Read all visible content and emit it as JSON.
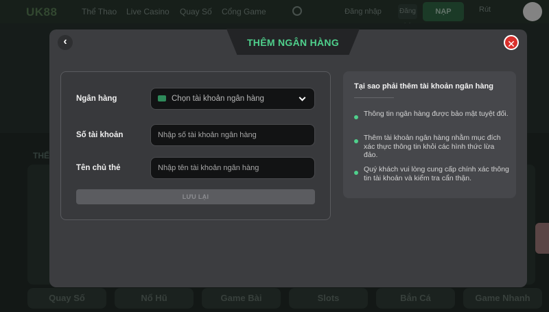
{
  "background": {
    "logo": "UK88",
    "nav": [
      "Thể Thao",
      "Live Casino",
      "Quay Số",
      "Cổng Game"
    ],
    "login_label": "Đăng nhập",
    "signup_label": "Đăng ký",
    "deposit_label": "NẠP",
    "withdraw_label": "Rút",
    "section_title": "THỂ",
    "bottom_tabs": [
      "Quay Số",
      "Nổ Hũ",
      "Game Bài",
      "Slots",
      "Bắn Cá",
      "Game Nhanh"
    ]
  },
  "modal": {
    "title": "THÊM NGÂN HÀNG",
    "back_icon": "‹",
    "close_icon": "✕",
    "form": {
      "bank_label": "Ngân hàng",
      "bank_select_value": "Chọn tài khoản ngân hàng",
      "account_number_label": "Số tài khoản",
      "account_number_placeholder": "Nhập số tài khoản ngân hàng",
      "holder_name_label": "Tên chủ thẻ",
      "holder_name_placeholder": "Nhập tên tài khoản ngân hàng",
      "save_label": "LƯU LẠI"
    },
    "info": {
      "title": "Tại sao phải thêm tài khoản ngân hàng",
      "items": [
        "Thông tin ngân hàng được bảo mật tuyệt đối.",
        "Thêm tài khoản ngân hàng nhằm mục đích xác thực thông tin khỏi các hình thức lừa đảo.",
        "Quý khách vui lòng cung cấp chính xác thông tin tài khoản và kiểm tra cẩn thận."
      ]
    }
  },
  "colors": {
    "accent": "#4fd08c",
    "close": "#d9302c",
    "modal_bg": "#3c3d40"
  }
}
